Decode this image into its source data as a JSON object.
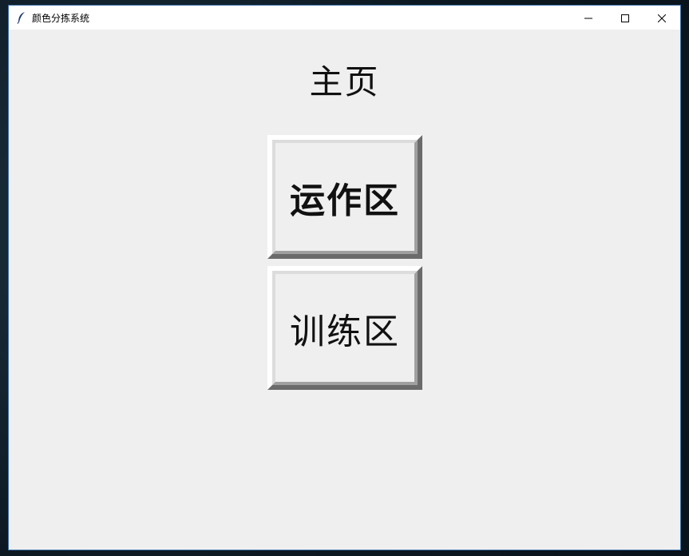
{
  "window": {
    "title": "颜色分拣系统",
    "controls": {
      "minimize_icon": "minimize-icon",
      "maximize_icon": "maximize-icon",
      "close_icon": "close-icon"
    }
  },
  "main": {
    "heading": "主页",
    "buttons": [
      {
        "label": "运作区"
      },
      {
        "label": "训练区"
      }
    ]
  },
  "colors": {
    "window_bg": "#efefef",
    "titlebar_bg": "#ffffff",
    "text": "#111111"
  }
}
